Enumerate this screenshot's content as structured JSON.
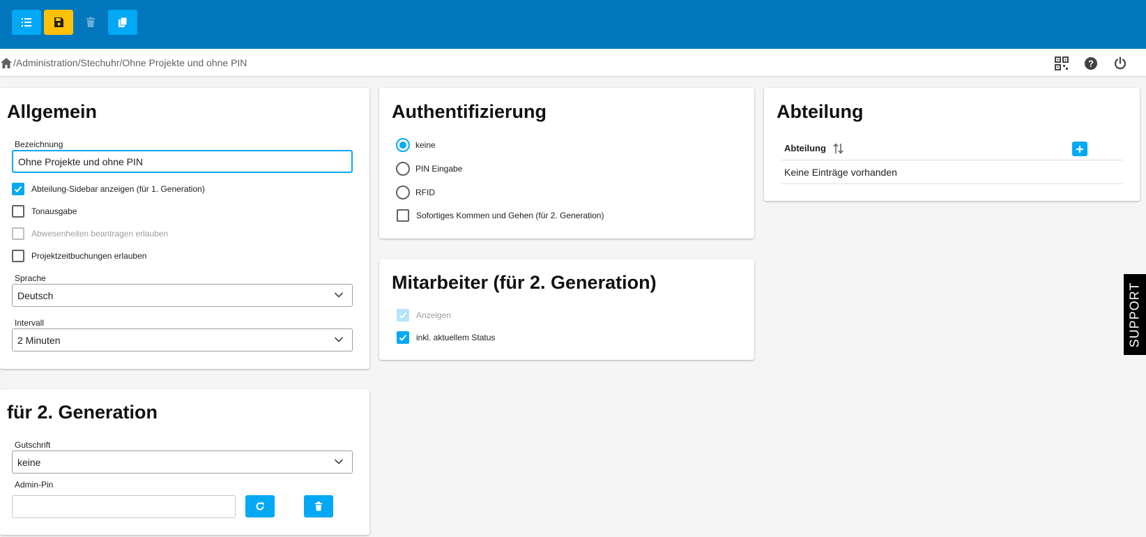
{
  "toolbar": {
    "icons": {
      "list": "list-icon",
      "save": "floppy-disk-icon",
      "delete": "trash-icon",
      "copy": "copy-icon"
    },
    "colors": {
      "bar": "#0277bd",
      "primary": "#03a9f4",
      "warning": "#ffc107"
    }
  },
  "breadcrumb": {
    "path": "/Administration/Stechuhr/Ohne Projekte und ohne PIN",
    "home_icon": "home-icon"
  },
  "header_icons": [
    "qr-code-icon",
    "help-icon",
    "power-icon"
  ],
  "allgemein": {
    "title": "Allgemein",
    "bezeichnung_label": "Bezeichnung",
    "bezeichnung_value": "Ohne Projekte und ohne PIN",
    "checkboxes": [
      {
        "label": "Abteilung-Sidebar anzeigen (für 1. Generation)",
        "checked": true,
        "disabled": false
      },
      {
        "label": "Tonausgabe",
        "checked": false,
        "disabled": false
      },
      {
        "label": "Abwesenheiten beantragen erlauben",
        "checked": false,
        "disabled": true
      },
      {
        "label": "Projektzeitbuchungen erlauben",
        "checked": false,
        "disabled": false
      }
    ],
    "sprache_label": "Sprache",
    "sprache_value": "Deutsch",
    "intervall_label": "Intervall",
    "intervall_value": "2 Minuten"
  },
  "generation2": {
    "title": "für 2. Generation",
    "gutschrift_label": "Gutschrift",
    "gutschrift_value": "keine",
    "adminpin_label": "Admin-Pin",
    "adminpin_value": ""
  },
  "auth": {
    "title": "Authentifizierung",
    "options": [
      {
        "label": "keine",
        "selected": true
      },
      {
        "label": "PIN Eingabe",
        "selected": false
      },
      {
        "label": "RFID",
        "selected": false
      }
    ],
    "sofort_label": "Sofortiges Kommen und Gehen (für 2. Generation)",
    "sofort_checked": false
  },
  "mitarbeiter": {
    "title": "Mitarbeiter (für 2. Generation)",
    "anzeigen_label": "Anzeigen",
    "anzeigen_checked": true,
    "anzeigen_disabled": true,
    "status_label": "inkl. aktuellem Status",
    "status_checked": true
  },
  "abteilung": {
    "title": "Abteilung",
    "column_header": "Abteilung",
    "empty_text": "Keine Einträge vorhanden"
  },
  "support": {
    "label": "SUPPORT"
  }
}
